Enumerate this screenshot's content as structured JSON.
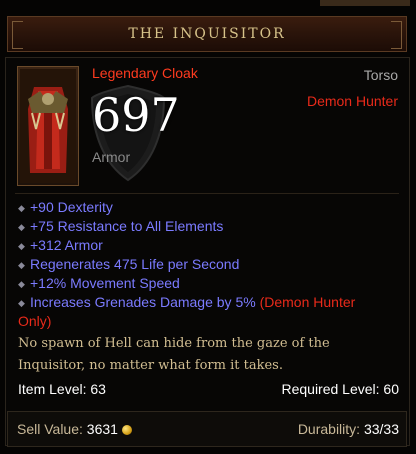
{
  "item": {
    "name": "THE INQUISITOR",
    "type": "Legendary Cloak",
    "slot": "Torso",
    "class_requirement": "Demon Hunter",
    "armor_value": "697",
    "armor_label": "Armor"
  },
  "affixes": [
    "+90 Dexterity",
    "+75 Resistance to All Elements",
    "+312 Armor",
    "Regenerates 475 Life per Second",
    "+12% Movement Speed",
    "Increases Grenades Damage by 5%"
  ],
  "affix_class_note_open": "(Demon Hunter",
  "affix_class_note_close": "Only)",
  "flavor_text": "No spawn of Hell can hide from the gaze of the Inquisitor, no matter what form it takes.",
  "item_level_label": "Item Level:",
  "item_level": "63",
  "required_level_label": "Required Level:",
  "required_level": "60",
  "sell_value_label": "Sell Value:",
  "sell_value": "3631",
  "durability_label": "Durability:",
  "durability": "33/33",
  "colors": {
    "legendary": "#ff3b1f",
    "magic_affix": "#7b7bff",
    "class_restriction": "#e82a1a",
    "flavor": "#d2be92",
    "title": "#d7c38a"
  }
}
